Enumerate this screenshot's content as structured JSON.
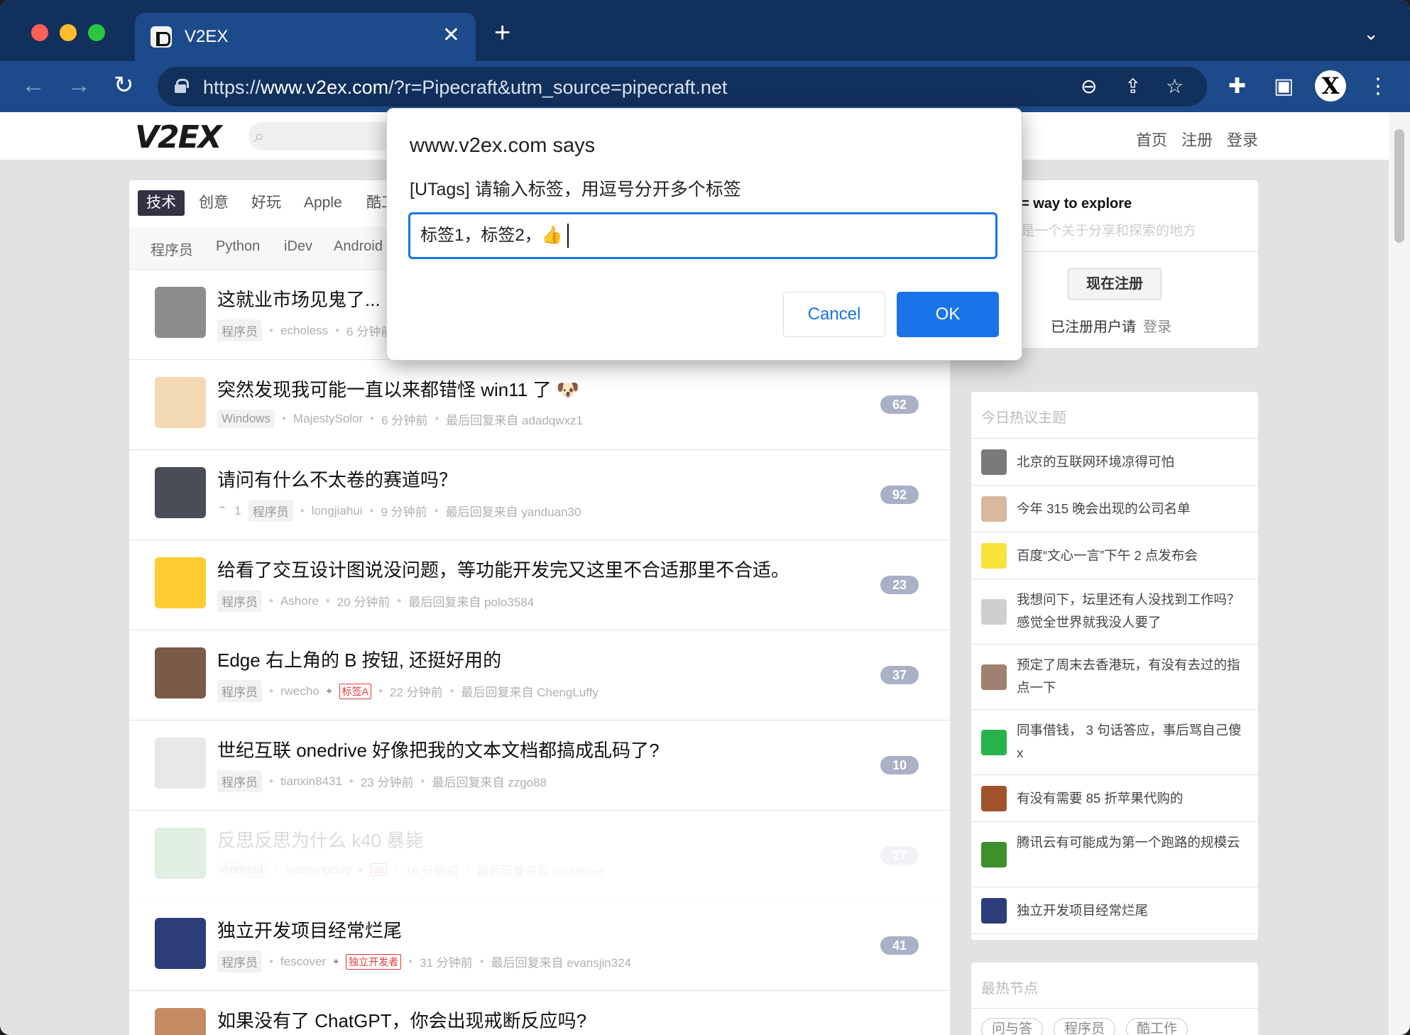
{
  "browser": {
    "tab_title": "V2EX",
    "tab_close": "✕",
    "new_tab": "+",
    "tab_menu": "⌄",
    "url_prefix": "https://",
    "url_host": "www.v2ex.com",
    "url_rest": "/?r=Pipecraft&utm_source=pipecraft.net",
    "profile_initial": "X"
  },
  "site": {
    "logo": "V2EX",
    "nav": [
      "首页",
      "注册",
      "登录"
    ]
  },
  "node_tabs": [
    "技术",
    "创意",
    "好玩",
    "Apple",
    "酷工作"
  ],
  "sub_tabs": [
    "程序员",
    "Python",
    "iDev",
    "Android"
  ],
  "topics": [
    {
      "title": "这就业市场见鬼了...",
      "node": "程序员",
      "author": "echoless",
      "time": "6 分钟前",
      "last_reply": "",
      "replies": "",
      "votes": "",
      "tags": [],
      "avatar_color": "#8d8d8d",
      "faded": false
    },
    {
      "title": "突然发现我可能一直以来都错怪 win11 了 🐶",
      "node": "Windows",
      "author": "MajestySolor",
      "time": "6 分钟前",
      "last_reply": "最后回复来自 adadqwxz1",
      "replies": "62",
      "votes": "",
      "tags": [],
      "avatar_color": "#f3d9b5",
      "faded": false
    },
    {
      "title": "请问有什么不太卷的赛道吗？",
      "node": "程序员",
      "author": "longjiahui",
      "time": "9 分钟前",
      "last_reply": "最后回复来自 yanduan30",
      "replies": "92",
      "votes": "1",
      "tags": [],
      "avatar_color": "#4a4d58",
      "faded": false
    },
    {
      "title": "给看了交互设计图说没问题，等功能开发完又这里不合适那里不合适。",
      "node": "程序员",
      "author": "Ashore",
      "time": "20 分钟前",
      "last_reply": "最后回复来自 polo3584",
      "replies": "23",
      "votes": "",
      "tags": [],
      "avatar_color": "#ffcc33",
      "faded": false
    },
    {
      "title": "Edge 右上角的 B 按钮, 还挺好用的",
      "node": "程序员",
      "author": "rwecho",
      "time": "22 分钟前",
      "last_reply": "最后回复来自 ChengLuffy",
      "replies": "37",
      "votes": "",
      "tags": [
        "标签A"
      ],
      "avatar_color": "#7a5a48",
      "faded": false
    },
    {
      "title": "世纪互联 onedrive 好像把我的文本文档都搞成乱码了?",
      "node": "程序员",
      "author": "tianxin8431",
      "time": "23 分钟前",
      "last_reply": "最后回复来自 zzgo88",
      "replies": "10",
      "votes": "",
      "tags": [],
      "avatar_color": "#e8e8e8",
      "faded": false
    },
    {
      "title": "反思反思为什么 k40 暴毙",
      "node": "Android",
      "author": "sleepingdog",
      "time": "16 分钟前",
      "last_reply": "最后回复来自 makelove",
      "replies": "27",
      "votes": "",
      "tags": [
        "sb"
      ],
      "avatar_color": "#2e9b3e",
      "faded": true
    },
    {
      "title": "独立开发项目经常烂尾",
      "node": "程序员",
      "author": "fescover",
      "time": "31 分钟前",
      "last_reply": "最后回复来自 evansjin324",
      "replies": "41",
      "votes": "",
      "tags": [
        "独立开发者"
      ],
      "avatar_color": "#2c3d7a",
      "faded": false
    },
    {
      "title": "如果没有了 ChatGPT，你会出现戒断反应吗?",
      "node": "",
      "author": "",
      "time": "",
      "last_reply": "",
      "replies": "",
      "votes": "",
      "tags": [],
      "avatar_color": "#c58a63",
      "faded": false
    }
  ],
  "sidebar": {
    "welcome_title": "= way to explore",
    "welcome_sub": "是一个关于分享和探索的地方",
    "signup_label": "现在注册",
    "registered_text": "已注册用户请",
    "login_link": "登录",
    "hot_header": "今日热议主题",
    "hot_topics": [
      {
        "text": "北京的互联网环境凉得可怕",
        "avatar_color": "#7a7a7a"
      },
      {
        "text": "今年 315 晚会出现的公司名单",
        "avatar_color": "#d9b8a0"
      },
      {
        "text": "百度“文心一言”下午 2 点发布会",
        "avatar_color": "#f7e23b"
      },
      {
        "text": "我想问下，坛里还有人没找到工作吗？感觉全世界就我没人要了",
        "avatar_color": "#cfcfcf"
      },
      {
        "text": "预定了周末去香港玩，有没有去过的指点一下",
        "avatar_color": "#a08070"
      },
      {
        "text": "同事借钱， 3 句话答应，事后骂自己傻 x",
        "avatar_color": "#27b24a"
      },
      {
        "text": "有没有需要 85 折苹果代购的",
        "avatar_color": "#a0522d"
      },
      {
        "text": "腾讯云有可能成为第一个跑路的规模云",
        "avatar_color": "#3f8f2a"
      },
      {
        "text": "独立开发项目经常烂尾",
        "avatar_color": "#2c3d7a"
      }
    ],
    "nodes_header": "最热节点",
    "hot_nodes": [
      "问与答",
      "程序员",
      "酷工作"
    ]
  },
  "dialog": {
    "title": "www.v2ex.com says",
    "message": "[UTags] 请输入标签，用逗号分开多个标签",
    "input_value": "标签1，标签2，👍",
    "cancel_label": "Cancel",
    "ok_label": "OK"
  },
  "colors": {
    "chrome_dark": "#12305c",
    "chrome_toolbar": "#1d4a8a",
    "accent": "#1a73e8",
    "reply_badge": "#aab0c6",
    "tag_red": "#e03a3a"
  }
}
